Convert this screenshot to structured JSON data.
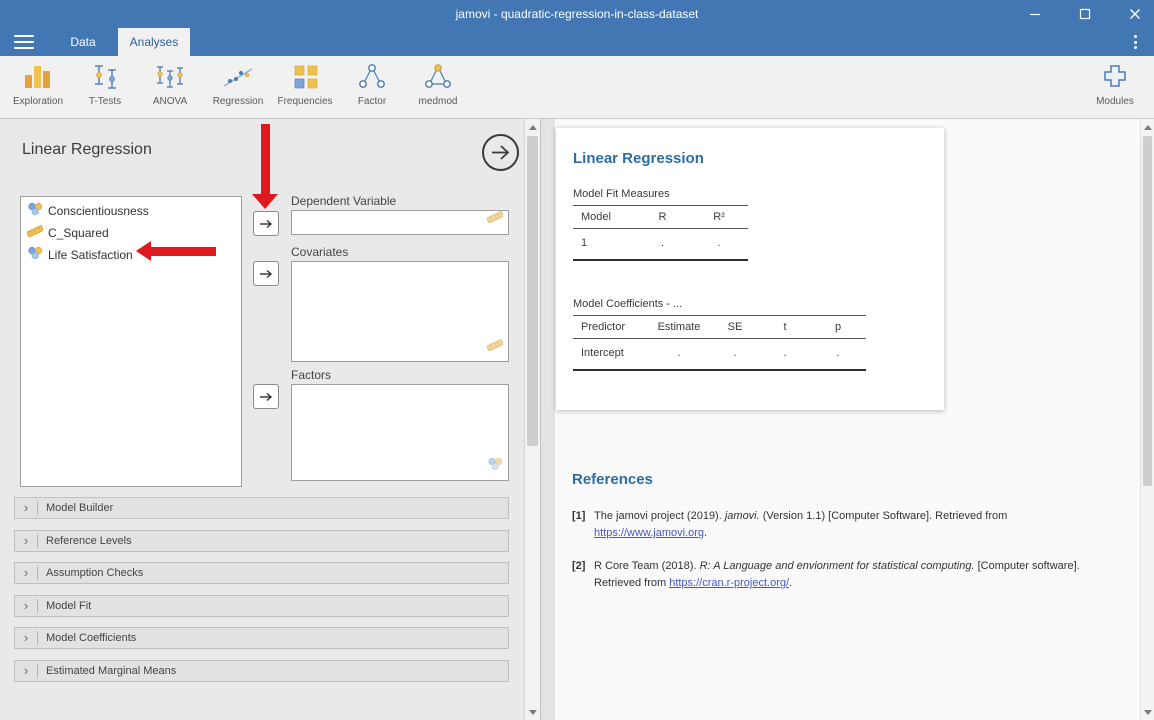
{
  "colors": {
    "titlebar_blue": "#4377b4",
    "ribbon_bg": "#f1f1f1",
    "heading_blue": "#2e6da4",
    "link_blue": "#4458c7",
    "annotation_red": "#e0181f",
    "icon_orange": "#f2c050",
    "icon_blue": "#4a7ab5"
  },
  "window": {
    "title": "jamovi - quadratic-regression-in-class-dataset"
  },
  "tabbar": {
    "tabs": [
      {
        "label": "Data"
      },
      {
        "label": "Analyses"
      }
    ]
  },
  "ribbon": {
    "items": [
      {
        "label": "Exploration"
      },
      {
        "label": "T-Tests"
      },
      {
        "label": "ANOVA"
      },
      {
        "label": "Regression"
      },
      {
        "label": "Frequencies"
      },
      {
        "label": "Factor"
      },
      {
        "label": "medmod"
      }
    ],
    "modules": {
      "label": "Modules"
    }
  },
  "analysis": {
    "title": "Linear Regression",
    "variables": [
      {
        "name": "Conscientiousness",
        "type": "nominal"
      },
      {
        "name": "C_Squared",
        "type": "continuous"
      },
      {
        "name": "Life Satisfaction",
        "type": "nominal"
      }
    ],
    "dependent_variable_label": "Dependent Variable",
    "covariates_label": "Covariates",
    "factors_label": "Factors",
    "sections": [
      "Model Builder",
      "Reference Levels",
      "Assumption Checks",
      "Model Fit",
      "Model Coefficients",
      "Estimated Marginal Means"
    ]
  },
  "results": {
    "title": "Linear Regression",
    "model_fit": {
      "caption": "Model Fit Measures",
      "columns": [
        "Model",
        "R",
        "R²"
      ],
      "rows": [
        [
          "1",
          ".",
          "."
        ]
      ]
    },
    "coefficients": {
      "caption": "Model Coefficients - ...",
      "columns": [
        "Predictor",
        "Estimate",
        "SE",
        "t",
        "p"
      ],
      "rows": [
        [
          "Intercept",
          ".",
          ".",
          ".",
          "."
        ]
      ]
    },
    "references": {
      "title": "References",
      "items": [
        {
          "num": "[1]",
          "pre": "The jamovi project (2019). ",
          "italic": "jamovi.",
          "mid": " (Version 1.1) [Computer Software]. Retrieved from ",
          "link": "https://www.jamovi.org",
          "post": "."
        },
        {
          "num": "[2]",
          "pre": "R Core Team (2018). ",
          "italic": "R: A Language and envionment for statistical computing.",
          "mid": " [Computer software]. Retrieved from ",
          "link": "https://cran.r-project.org/",
          "post": "."
        }
      ]
    }
  }
}
